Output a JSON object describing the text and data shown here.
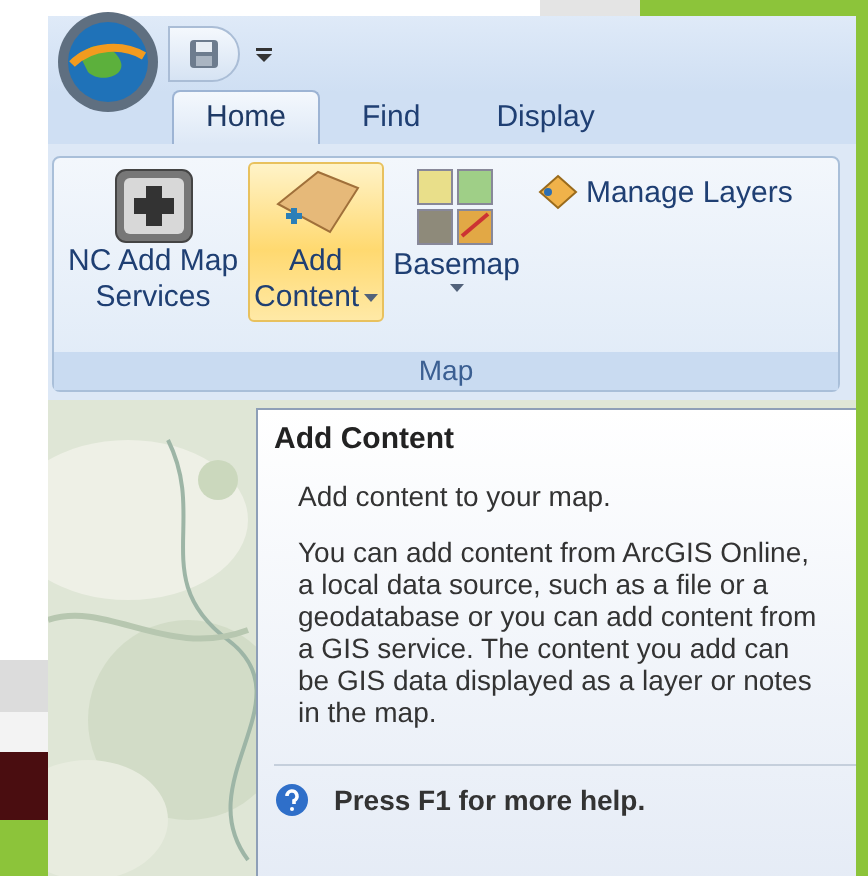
{
  "tabs": [
    {
      "label": "Home",
      "selected": true
    },
    {
      "label": "Find",
      "selected": false
    },
    {
      "label": "Display",
      "selected": false
    }
  ],
  "ribbon": {
    "group_title": "Map",
    "buttons": [
      {
        "kind": "large",
        "lines": [
          "NC Add Map",
          "Services"
        ],
        "highlighted": false,
        "dropdown": false
      },
      {
        "kind": "large",
        "lines": [
          "Add",
          "Content"
        ],
        "highlighted": true,
        "dropdown": true
      },
      {
        "kind": "gallery",
        "lines": [
          "Basemap"
        ],
        "highlighted": false,
        "dropdown": true
      },
      {
        "kind": "small",
        "lines": [
          "Manage Layers"
        ]
      }
    ]
  },
  "tooltip": {
    "title": "Add Content",
    "summary": "Add content to your map.",
    "body": "You can add content from ArcGIS Online, a local data source, such as a file or a geodatabase or you can add content from a GIS service. The content you add can be GIS data displayed as a layer or notes in the map.",
    "help": "Press F1 for more help."
  }
}
